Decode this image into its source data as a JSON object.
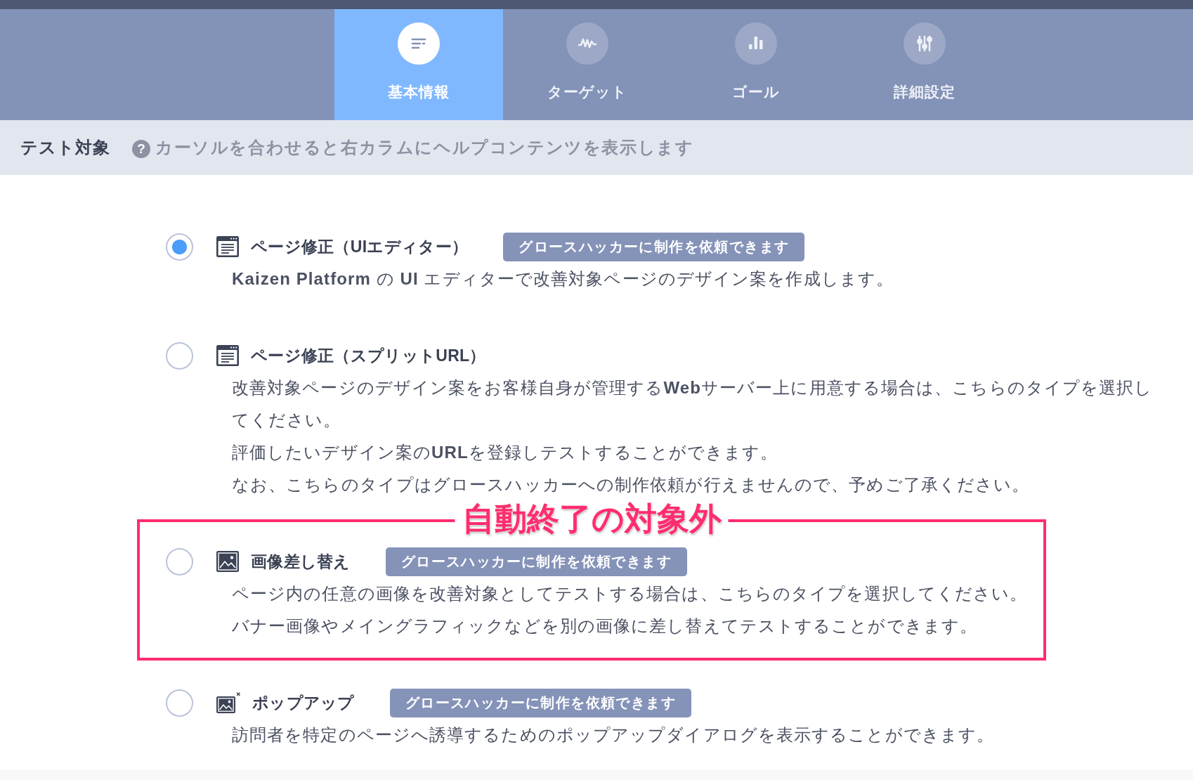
{
  "tabs": [
    {
      "label": "基本情報",
      "selected": true
    },
    {
      "label": "ターゲット",
      "selected": false
    },
    {
      "label": "ゴール",
      "selected": false
    },
    {
      "label": "詳細設定",
      "selected": false
    }
  ],
  "section": {
    "title": "テスト対象",
    "help_icon": "?",
    "help_text": "カーソルを合わせると右カラムにヘルプコンテンツを表示します"
  },
  "options": [
    {
      "title": "ページ修正（UIエディター）",
      "selected": true,
      "badge": "グロースハッカーに制作を依頼できます",
      "description": [
        "**Kaizen Platform** の **UI** エディターで改善対象ページのデザイン案を作成します。"
      ]
    },
    {
      "title": "ページ修正（スプリットURL）",
      "selected": false,
      "description": [
        "改善対象ページのデザイン案をお客様自身が管理する**Web**サーバー上に用意する場合は、こちらのタイプを選択してください。",
        "評価したいデザイン案の**URL**を登録しテストすることができます。",
        "なお、こちらのタイプはグロースハッカーへの制作依頼が行えませんので、予めご了承ください。"
      ]
    },
    {
      "title": "画像差し替え",
      "selected": false,
      "badge": "グロースハッカーに制作を依頼できます",
      "annotation": "自動終了の対象外",
      "description": [
        "ページ内の任意の画像を改善対象としてテストする場合は、こちらのタイプを選択してください。",
        "バナー画像やメイングラフィックなどを別の画像に差し替えてテストすることができます。"
      ]
    },
    {
      "title": "ポップアップ",
      "selected": false,
      "badge": "グロースハッカーに制作を依頼できます",
      "description": [
        "訪問者を特定のページへ誘導するためのポップアップダイアログを表示することができます。"
      ]
    }
  ]
}
